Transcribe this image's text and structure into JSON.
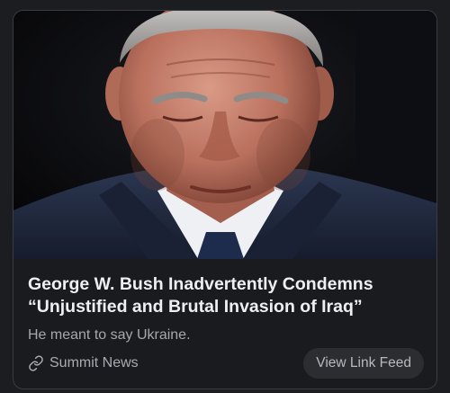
{
  "card": {
    "image_alt": "George W. Bush looking down",
    "headline_line1": "George W. Bush Inadvertently Condemns",
    "headline_line2": "“Unjustified and Brutal Invasion of Iraq”",
    "subtitle": "He meant to say Ukraine.",
    "source_icon": "link-icon",
    "source_name": "Summit News",
    "feed_button_label": "View Link Feed"
  },
  "colors": {
    "page_background": "#1c1d21",
    "card_background": "#1a1b1e",
    "card_border": "#3a3c42",
    "headline": "#eeeff2",
    "muted_text": "#a6a8ad",
    "button_background": "#2b2d31"
  }
}
